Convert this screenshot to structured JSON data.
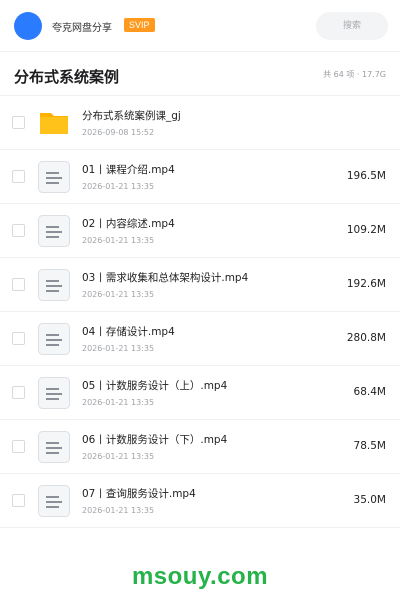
{
  "header": {
    "app_name": "夸克网盘分享",
    "badge": "SVIP",
    "search_placeholder": "搜索"
  },
  "folder": {
    "title": "分布式系统案例",
    "meta": "共 64 项 · 17.7G"
  },
  "files": [
    {
      "type": "folder",
      "icon": "folder-icon",
      "name": "分布式系统案例课_gj",
      "date": "2026-09-08 15:52",
      "size": ""
    },
    {
      "type": "file",
      "icon": "video-file-icon",
      "name": "01丨课程介绍.mp4",
      "date": "2026-01-21 13:35",
      "size": "196.5M"
    },
    {
      "type": "file",
      "icon": "video-file-icon",
      "name": "02丨内容综述.mp4",
      "date": "2026-01-21 13:35",
      "size": "109.2M"
    },
    {
      "type": "file",
      "icon": "video-file-icon",
      "name": "03丨需求收集和总体架构设计.mp4",
      "date": "2026-01-21 13:35",
      "size": "192.6M"
    },
    {
      "type": "file",
      "icon": "video-file-icon",
      "name": "04丨存储设计.mp4",
      "date": "2026-01-21 13:35",
      "size": "280.8M"
    },
    {
      "type": "file",
      "icon": "video-file-icon",
      "name": "05丨计数服务设计（上）.mp4",
      "date": "2026-01-21 13:35",
      "size": "68.4M"
    },
    {
      "type": "file",
      "icon": "video-file-icon",
      "name": "06丨计数服务设计（下）.mp4",
      "date": "2026-01-21 13:35",
      "size": "78.5M"
    },
    {
      "type": "file",
      "icon": "video-file-icon",
      "name": "07丨查询服务设计.mp4",
      "date": "2026-01-21 13:35",
      "size": "35.0M"
    }
  ],
  "watermark": "msouy.com",
  "colors": {
    "accent": "#2b7bff",
    "svip": "#ff9a1f",
    "folder": "#ffc21a",
    "watermark": "#27b24a"
  }
}
